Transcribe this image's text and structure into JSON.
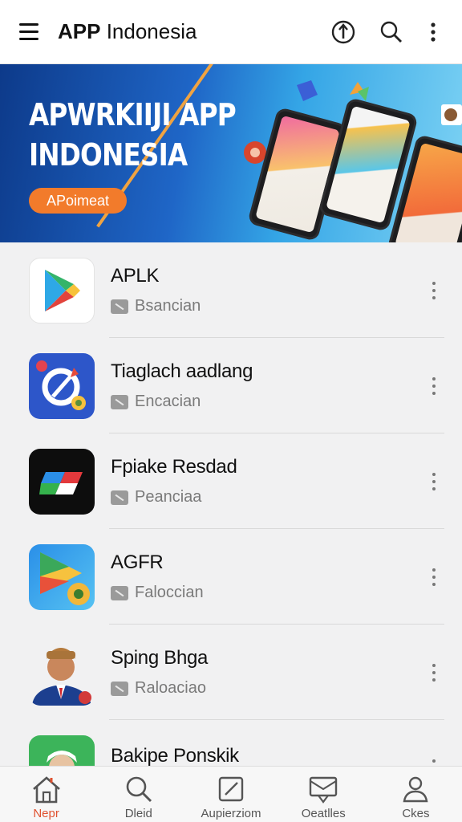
{
  "topbar": {
    "title_bold": "APP",
    "title_rest": " Indonesia",
    "icons": [
      "menu-icon",
      "info-icon",
      "search-icon",
      "more-vert-icon"
    ]
  },
  "banner": {
    "headline_line1": "APWRKIIJI APP",
    "headline_line2": "INDONESIA",
    "cta_label": "APoimeat",
    "accent": "#f27b2b"
  },
  "apps": [
    {
      "name": "APLK",
      "subtitle": "Bsancian",
      "icon": "play-store-icon"
    },
    {
      "name": "Tiaglach aadlang",
      "subtitle": "Encacian",
      "icon": "compass-app-icon"
    },
    {
      "name": "Fpiake Resdad",
      "subtitle": "Peanciaa",
      "icon": "flag-app-icon"
    },
    {
      "name": "AGFR",
      "subtitle": "Faloccian",
      "icon": "play-badge-app-icon"
    },
    {
      "name": "Sping Bhga",
      "subtitle": "Raloaciao",
      "icon": "person-avatar-icon"
    },
    {
      "name": "Bakipe Ponskik",
      "subtitle": "",
      "icon": "person-green-app-icon"
    }
  ],
  "bottom_nav": [
    {
      "label": "Nepr",
      "icon": "home-icon",
      "active": true
    },
    {
      "label": "Dleid",
      "icon": "search-icon",
      "active": false
    },
    {
      "label": "Aupierziom",
      "icon": "edit-icon",
      "active": false
    },
    {
      "label": "Oeatlles",
      "icon": "inbox-icon",
      "active": false
    },
    {
      "label": "Ckes",
      "icon": "profile-icon",
      "active": false
    }
  ]
}
